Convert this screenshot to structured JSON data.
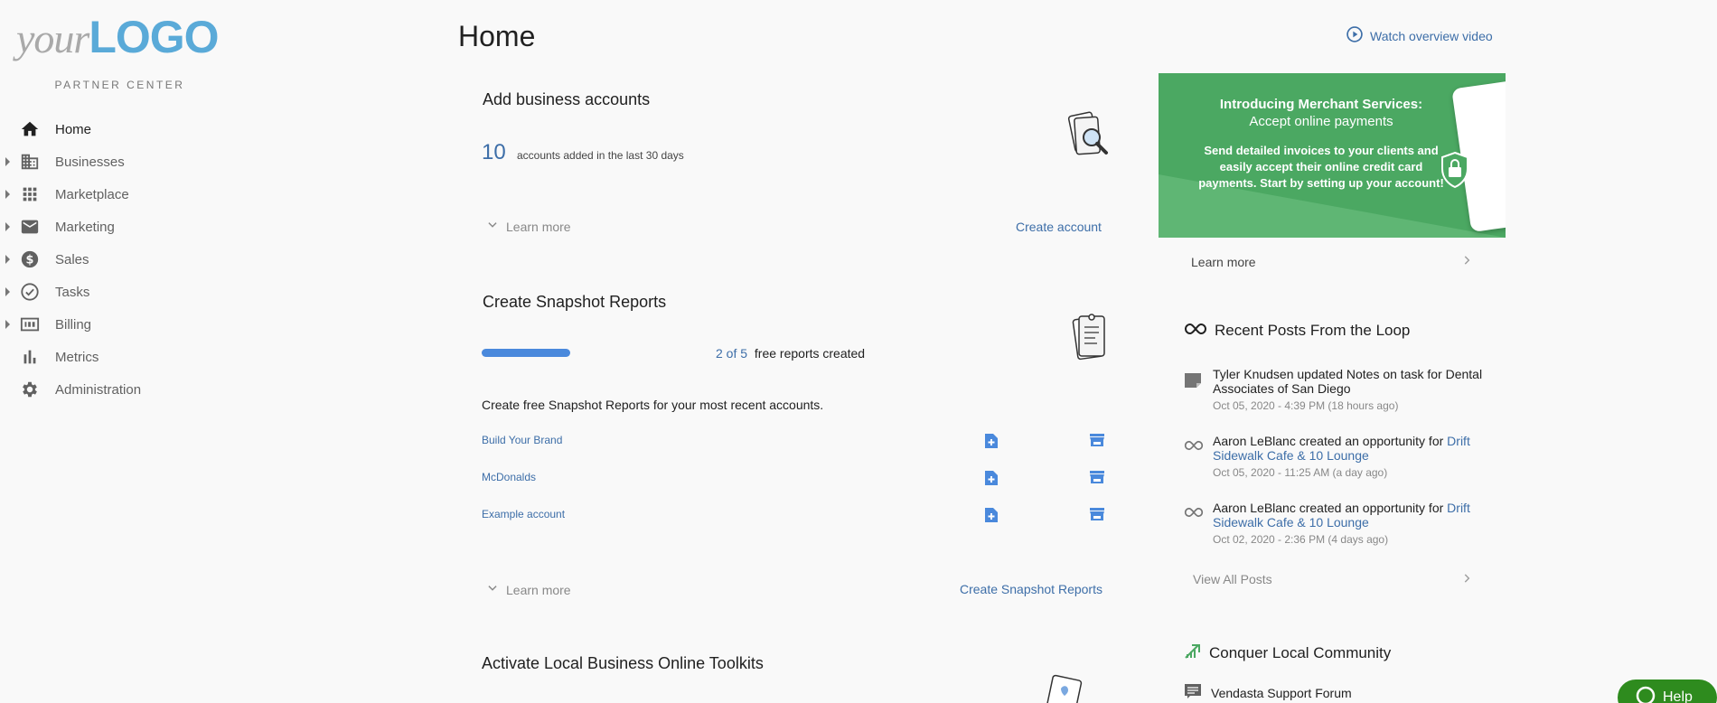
{
  "brand": {
    "logo_your": "your",
    "logo_brand": "LOGO",
    "partner_center": "PARTNER CENTER"
  },
  "nav": {
    "items": [
      {
        "label": "Home",
        "icon": "home-icon",
        "active": true
      },
      {
        "label": "Businesses",
        "icon": "building-icon"
      },
      {
        "label": "Marketplace",
        "icon": "grid-icon"
      },
      {
        "label": "Marketing",
        "icon": "mail-icon"
      },
      {
        "label": "Sales",
        "icon": "dollar-icon"
      },
      {
        "label": "Tasks",
        "icon": "check-circle-icon"
      },
      {
        "label": "Billing",
        "icon": "billing-icon"
      },
      {
        "label": "Metrics",
        "icon": "bar-chart-icon"
      },
      {
        "label": "Administration",
        "icon": "gear-icon"
      }
    ]
  },
  "header": {
    "title": "Home",
    "watch_video": "Watch overview video"
  },
  "add_accounts": {
    "title": "Add business accounts",
    "count": "10",
    "count_label": "accounts added in the last 30 days",
    "learn_more": "Learn more",
    "action": "Create account"
  },
  "snapshot": {
    "title": "Create Snapshot Reports",
    "progress_text": "2 of 5",
    "progress_suffix": "free reports created",
    "progress_fraction": 0.4,
    "description": "Create free Snapshot Reports for your most recent accounts.",
    "rows": [
      {
        "name": "Build Your Brand"
      },
      {
        "name": "McDonalds"
      },
      {
        "name": "Example account"
      }
    ],
    "learn_more": "Learn more",
    "action": "Create Snapshot Reports"
  },
  "toolkits": {
    "title": "Activate Local Business Online Toolkits"
  },
  "promo": {
    "title_line1": "Introducing Merchant Services:",
    "title_line2": "Accept online payments",
    "body": "Send detailed invoices to your clients and easily accept their online credit card payments. Start by setting up your account!",
    "learn_more": "Learn more"
  },
  "loop": {
    "title": "Recent Posts From the Loop",
    "posts": [
      {
        "text": "Tyler Knudsen updated Notes on task for Dental Associates of San Diego",
        "link": "",
        "time": "Oct 05, 2020 - 4:39 PM (18 hours ago)",
        "icon": "note-icon"
      },
      {
        "text": "Aaron LeBlanc created an opportunity for ",
        "link": "Drift Sidewalk Cafe & 10 Lounge",
        "time": "Oct 05, 2020 - 11:25 AM (a day ago)",
        "icon": "loop-icon"
      },
      {
        "text": "Aaron LeBlanc created an opportunity for ",
        "link": "Drift Sidewalk Cafe & 10 Lounge",
        "time": "Oct 02, 2020 - 2:36 PM (4 days ago)",
        "icon": "loop-icon"
      }
    ],
    "view_all": "View All Posts"
  },
  "community": {
    "title": "Conquer Local Community",
    "support": "Vendasta Support Forum"
  },
  "help": {
    "label": "Help"
  },
  "colors": {
    "accent": "#3d6ea8",
    "promo": "#4ba862",
    "help": "#2e8b1e",
    "progress": "#4a89dc"
  }
}
